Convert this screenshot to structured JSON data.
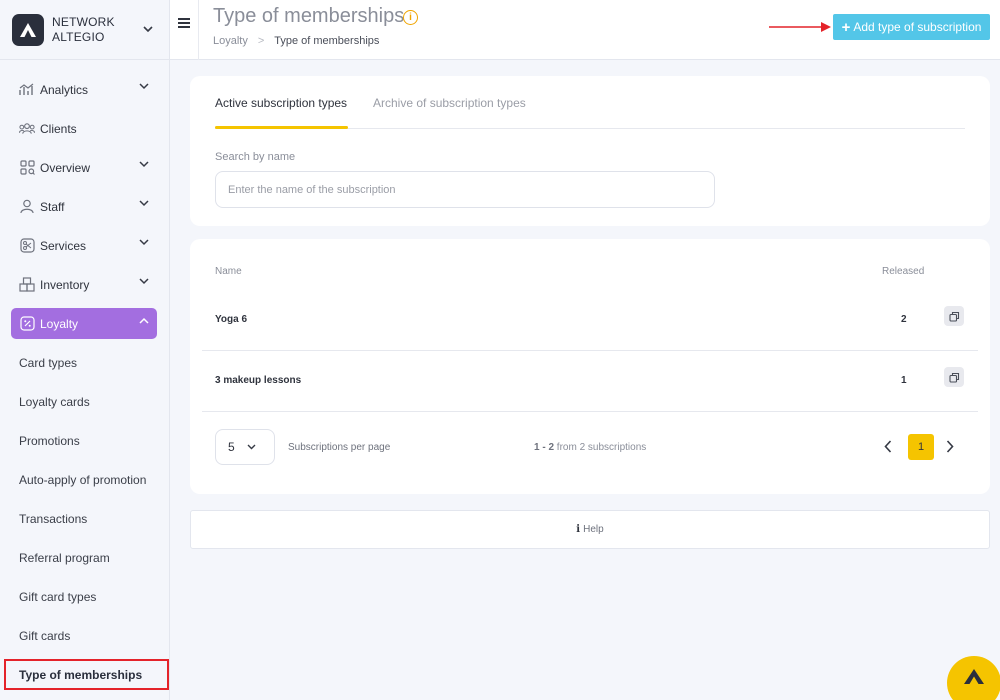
{
  "brand": {
    "name_line1": "NETWORK",
    "name_line2": "ALTEGIO",
    "logo_icon": "altegio-logo-icon"
  },
  "sidebar": {
    "items": [
      {
        "label": "Analytics",
        "icon": "analytics-icon",
        "has_chevron": true
      },
      {
        "label": "Clients",
        "icon": "clients-icon",
        "has_chevron": false
      },
      {
        "label": "Overview",
        "icon": "overview-icon",
        "has_chevron": true
      },
      {
        "label": "Staff",
        "icon": "staff-icon",
        "has_chevron": true
      },
      {
        "label": "Services",
        "icon": "services-icon",
        "has_chevron": true
      },
      {
        "label": "Inventory",
        "icon": "inventory-icon",
        "has_chevron": true
      },
      {
        "label": "Loyalty",
        "icon": "loyalty-icon",
        "has_chevron": true,
        "active": true
      }
    ],
    "loyalty_sub": [
      "Card types",
      "Loyalty cards",
      "Promotions",
      "Auto-apply of promotion",
      "Transactions",
      "Referral program",
      "Gift card types",
      "Gift cards",
      "Type of memberships"
    ],
    "active_color": "#a36ee0"
  },
  "header": {
    "title": "Type of memberships",
    "info_icon": "i",
    "breadcrumb": {
      "parent": "Loyalty",
      "separator": ">",
      "current": "Type of memberships"
    },
    "add_button_label": "Add type of subscription",
    "add_button_color": "#53c6e8"
  },
  "tabs": {
    "active": "Active subscription types",
    "archive": "Archive of subscription types"
  },
  "search": {
    "label": "Search by name",
    "placeholder": "Enter the name of the subscription",
    "value": ""
  },
  "table": {
    "columns": {
      "name": "Name",
      "released": "Released"
    },
    "rows": [
      {
        "name": "Yoga 6",
        "released": "2"
      },
      {
        "name": "3 makeup lessons",
        "released": "1"
      }
    ]
  },
  "pagination": {
    "per_page_value": "5",
    "per_page_label": "Subscriptions per page",
    "range_bold": "1 - 2",
    "range_rest": " from 2 subscriptions",
    "current_page": "1",
    "accent_color": "#f5c400"
  },
  "help": {
    "label": "Help"
  }
}
